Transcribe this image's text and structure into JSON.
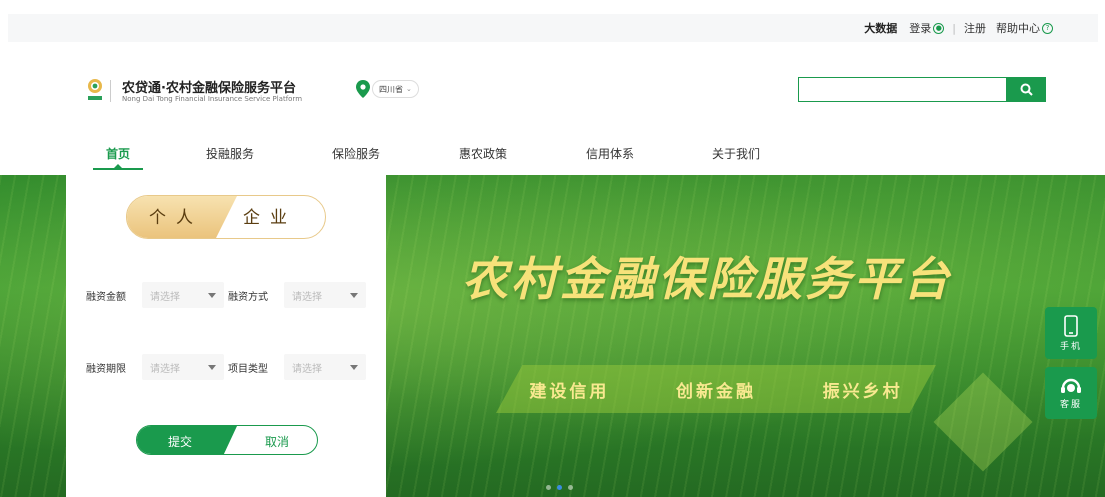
{
  "topbar": {
    "big_data": "大数据",
    "login": "登录",
    "divider": "|",
    "register": "注册",
    "help": "帮助中心"
  },
  "header": {
    "brand_title": "农贷通·农村金融保险服务平台",
    "brand_subtitle": "Nong Dai Tong Financial Insurance Service Platform",
    "location": "四川省",
    "search_placeholder": ""
  },
  "nav": {
    "items": [
      "首页",
      "投融服务",
      "保险服务",
      "惠农政策",
      "信用体系",
      "关于我们"
    ],
    "active_index": 0
  },
  "panel": {
    "tabs": [
      "个人",
      "企业"
    ],
    "fields": [
      {
        "label": "融资金额",
        "placeholder": "请选择"
      },
      {
        "label": "融资方式",
        "placeholder": "请选择"
      },
      {
        "label": "融资期限",
        "placeholder": "请选择"
      },
      {
        "label": "项目类型",
        "placeholder": "请选择"
      }
    ],
    "submit_label": "提交",
    "cancel_label": "取消"
  },
  "banner": {
    "title": "农村金融保险服务平台",
    "slogans": [
      "建设信用",
      "创新金融",
      "振兴乡村"
    ],
    "carousel_count": 3,
    "carousel_active": 1
  },
  "float": {
    "mobile": "手机",
    "service": "客服"
  },
  "colors": {
    "brand_green": "#1a9a4d",
    "gold": "#f7e27a"
  }
}
